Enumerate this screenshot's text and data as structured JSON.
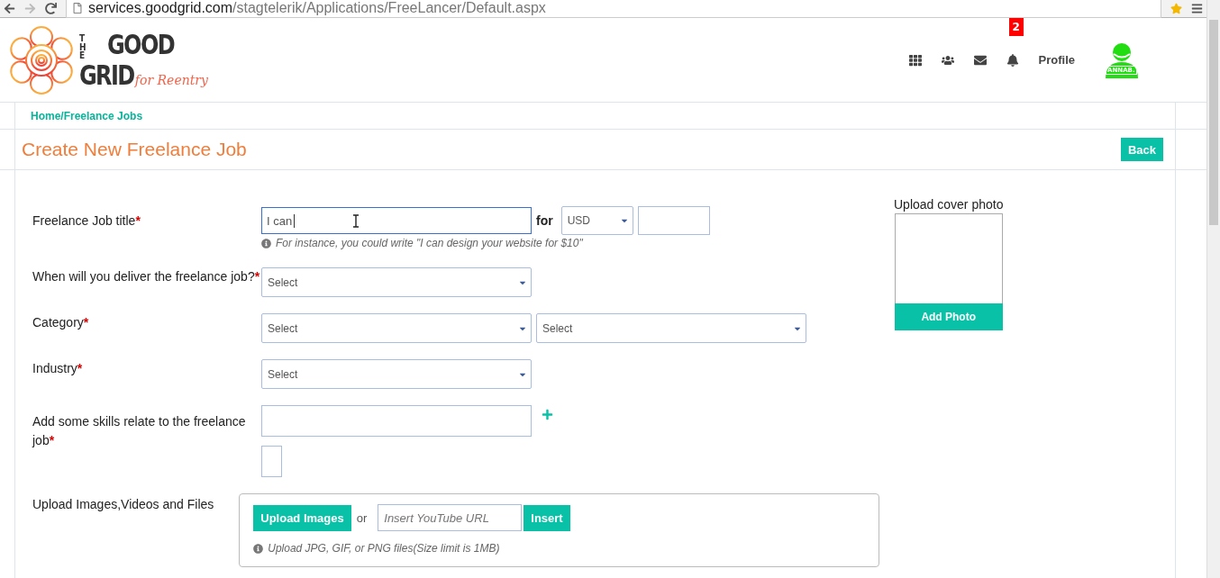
{
  "browser": {
    "url_host": "services.goodgrid.com",
    "url_path": "/stagtelerik/Applications/FreeLancer/Default.aspx"
  },
  "header": {
    "logo": {
      "the": "THE",
      "good": "GOOD",
      "grid": "GRID",
      "tagline": "for Reentry"
    },
    "notification_count": "2",
    "profile_label": "Profile",
    "avatar_tag": "ANNAB."
  },
  "breadcrumb": "Home/Freelance Jobs",
  "page_title": "Create New Freelance Job",
  "back_button": "Back",
  "form": {
    "fields": [
      {
        "kind": "title",
        "label": "Freelance Job title",
        "required_mark": "*",
        "value": "I can",
        "focused": true,
        "connector": "for",
        "currency": "USD",
        "hint": "For instance, you could write \"I can design your website for $10\""
      },
      {
        "kind": "select",
        "label": "When will you deliver the freelance job?",
        "required_mark": "*",
        "selects": [
          "Select"
        ]
      },
      {
        "kind": "select",
        "label": "Category",
        "required_mark": "*",
        "selects": [
          "Select",
          "Select"
        ]
      },
      {
        "kind": "select",
        "label": "Industry",
        "required_mark": "*",
        "selects": [
          "Select"
        ]
      },
      {
        "kind": "skills",
        "label": "Add some skills relate to the freelance job",
        "required_mark": "*"
      },
      {
        "kind": "upload",
        "label": "Upload Images,Videos and Files",
        "upload_button": "Upload Images",
        "or": "or",
        "url_placeholder": "Insert YouTube URL",
        "insert_button": "Insert",
        "hint": "Upload JPG, GIF, or PNG files(Size limit is 1MB)"
      }
    ]
  },
  "cover_photo": {
    "title": "Upload cover photo",
    "button": "Add Photo"
  }
}
